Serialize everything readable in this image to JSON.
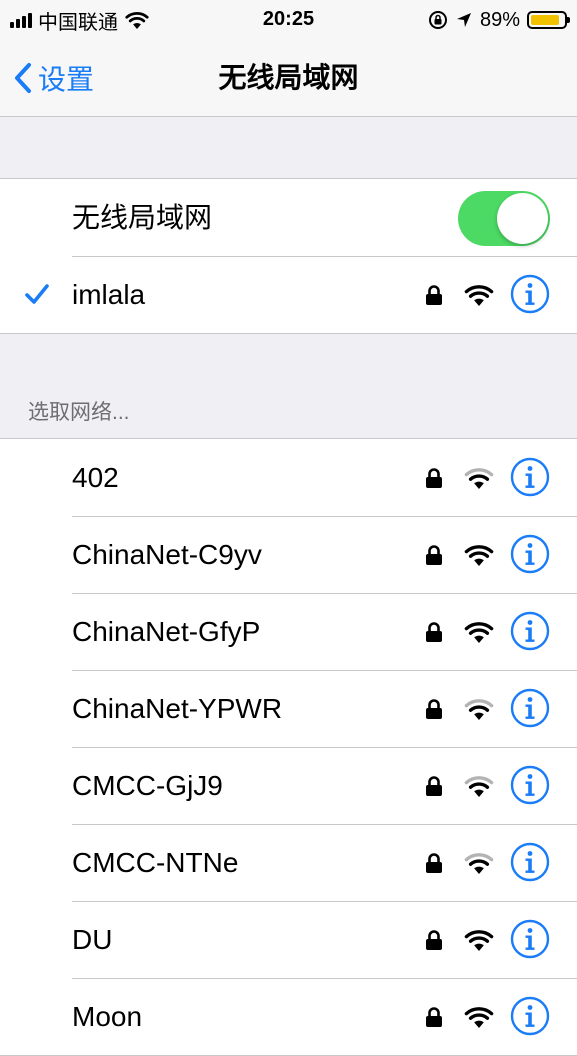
{
  "status_bar": {
    "carrier": "中国联通",
    "time": "20:25",
    "battery_percent": "89%",
    "battery_level": 0.89,
    "battery_color": "#f2c200",
    "icons": [
      "signal-bars-icon",
      "wifi-icon",
      "orientation-lock-icon",
      "location-arrow-icon",
      "battery-icon"
    ]
  },
  "nav": {
    "back_label": "设置",
    "title": "无线局域网"
  },
  "wifi_toggle": {
    "label": "无线局域网",
    "on": true,
    "color": "#4cd964"
  },
  "connected_network": {
    "name": "imlala",
    "secured": true,
    "signal": "full"
  },
  "section_header": "选取网络...",
  "networks": [
    {
      "name": "402",
      "secured": true,
      "signal": "weak"
    },
    {
      "name": "ChinaNet-C9yv",
      "secured": true,
      "signal": "full"
    },
    {
      "name": "ChinaNet-GfyP",
      "secured": true,
      "signal": "full"
    },
    {
      "name": "ChinaNet-YPWR",
      "secured": true,
      "signal": "weak"
    },
    {
      "name": "CMCC-GjJ9",
      "secured": true,
      "signal": "weak"
    },
    {
      "name": "CMCC-NTNe",
      "secured": true,
      "signal": "weak"
    },
    {
      "name": "DU",
      "secured": true,
      "signal": "full"
    },
    {
      "name": "Moon",
      "secured": true,
      "signal": "full"
    }
  ],
  "accent_color": "#1a7cf7"
}
